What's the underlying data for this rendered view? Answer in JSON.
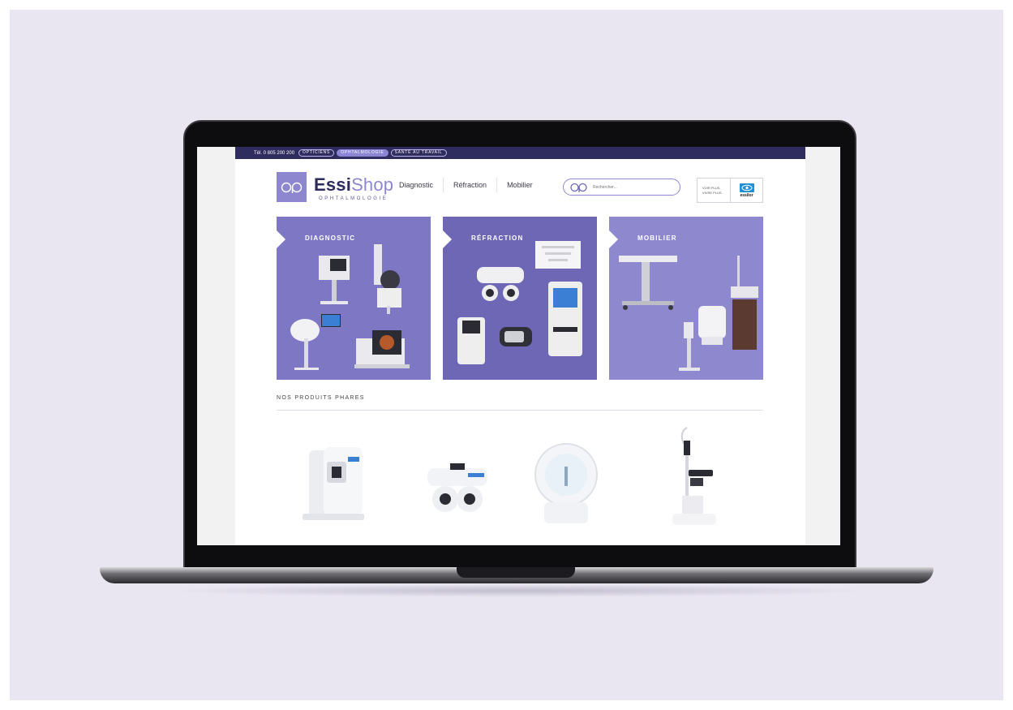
{
  "topbar": {
    "tel": "Tél. 0 805 200 200",
    "pills": [
      {
        "label": "OPTICIENS",
        "active": false
      },
      {
        "label": "OPHTALMOLOGIE",
        "active": true
      },
      {
        "label": "SANTÉ AU TRAVAIL",
        "active": false
      }
    ]
  },
  "header": {
    "brand_a": "Essi",
    "brand_b": "Shop",
    "brand_sub": "OPHTALMOLOGIE",
    "nav": [
      "Diagnostic",
      "Réfraction",
      "Mobilier"
    ],
    "search_placeholder": "Rechercher...",
    "partner_tagline_1": "VOIR PLUS.",
    "partner_tagline_2": "VIVRE PLUS.",
    "partner_brand": "essilor"
  },
  "categories": [
    {
      "title": "DIAGNOSTIC"
    },
    {
      "title": "RÉFRACTION"
    },
    {
      "title": "MOBILIER"
    }
  ],
  "featured": {
    "title": "NOS PRODUITS PHARES"
  },
  "colors": {
    "accent": "#8d87cf",
    "navy": "#2f2c5e",
    "background": "#e9e6f2"
  }
}
